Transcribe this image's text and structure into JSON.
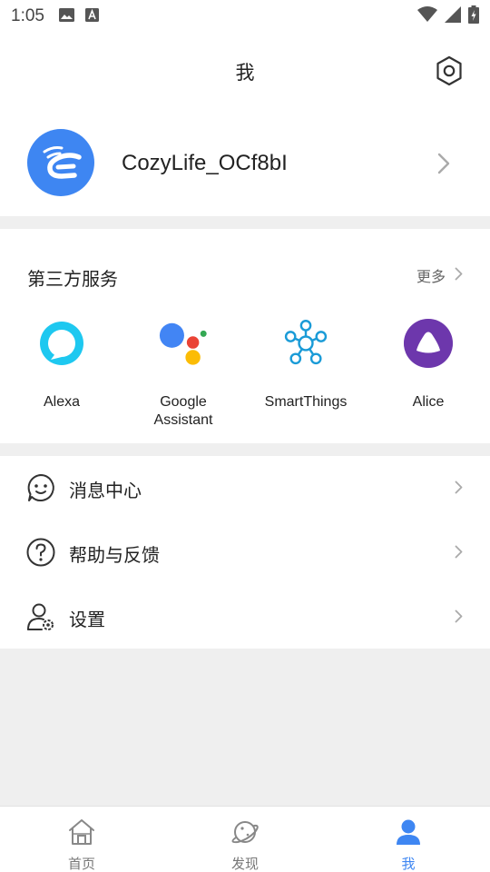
{
  "status_bar": {
    "time": "1:05"
  },
  "header": {
    "title": "我"
  },
  "profile": {
    "username": "CozyLife_OCf8bI"
  },
  "services": {
    "title": "第三方服务",
    "more_label": "更多",
    "items": [
      {
        "label": "Alexa",
        "icon": "alexa-icon"
      },
      {
        "label": "Google",
        "label2": "Assistant",
        "icon": "google-assistant-icon"
      },
      {
        "label": "SmartThings",
        "icon": "smartthings-icon"
      },
      {
        "label": "Alice",
        "icon": "alice-icon"
      }
    ]
  },
  "menu": [
    {
      "label": "消息中心",
      "icon": "message-icon"
    },
    {
      "label": "帮助与反馈",
      "icon": "help-icon"
    },
    {
      "label": "设置",
      "icon": "user-settings-icon"
    }
  ],
  "bottom_nav": {
    "items": [
      {
        "label": "首页",
        "icon": "home-icon"
      },
      {
        "label": "发现",
        "icon": "planet-icon"
      },
      {
        "label": "我",
        "icon": "person-icon",
        "active": true
      }
    ],
    "active_color": "#3e86f2"
  },
  "colors": {
    "accent": "#3e86f2",
    "background": "#efefef"
  }
}
